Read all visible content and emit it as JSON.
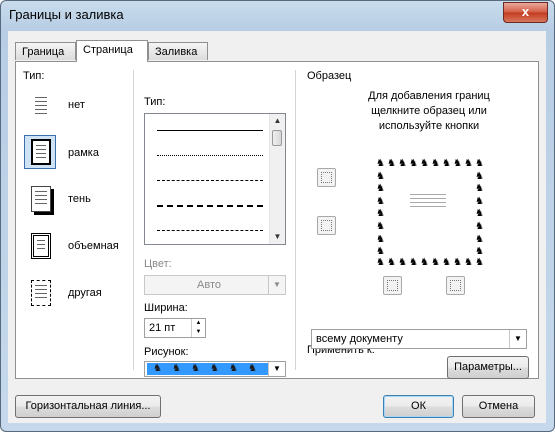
{
  "window": {
    "title": "Границы и заливка",
    "close_glyph": "x"
  },
  "tabs": [
    {
      "label": "Граница",
      "active": false
    },
    {
      "label": "Страница",
      "active": true
    },
    {
      "label": "Заливка",
      "active": false
    }
  ],
  "setting": {
    "label": "Тип:",
    "options": [
      {
        "label": "нет",
        "icon": "none-setting-icon",
        "selected": false
      },
      {
        "label": "рамка",
        "icon": "box-setting-icon",
        "selected": true
      },
      {
        "label": "тень",
        "icon": "shadow-setting-icon",
        "selected": false
      },
      {
        "label": "объемная",
        "icon": "3d-setting-icon",
        "selected": false
      },
      {
        "label": "другая",
        "icon": "custom-setting-icon",
        "selected": false
      }
    ]
  },
  "style": {
    "label": "Тип:",
    "lines": [
      "solid",
      "dotted",
      "dashed",
      "long-dash",
      "dash-dot"
    ]
  },
  "color": {
    "label": "Цвет:",
    "value": "Авто"
  },
  "width": {
    "label": "Ширина:",
    "value": "21 пт"
  },
  "art": {
    "label": "Рисунок:",
    "figure_glyph": "♞",
    "accent_color": "#3399ff"
  },
  "preview": {
    "label": "Образец",
    "hint": "Для добавления границ щелкните образец или используйте кнопки",
    "figure_glyph": "♞"
  },
  "apply_to": {
    "label": "Применить к:",
    "value": "всему документу"
  },
  "buttons": {
    "options": "Параметры...",
    "horizontal_line": "Горизонтальная линия...",
    "ok": "ОК",
    "cancel": "Отмена"
  },
  "colors": {
    "selection": "#3399ff",
    "title_gradient_top": "#c9dced",
    "close_red": "#c13b20"
  }
}
